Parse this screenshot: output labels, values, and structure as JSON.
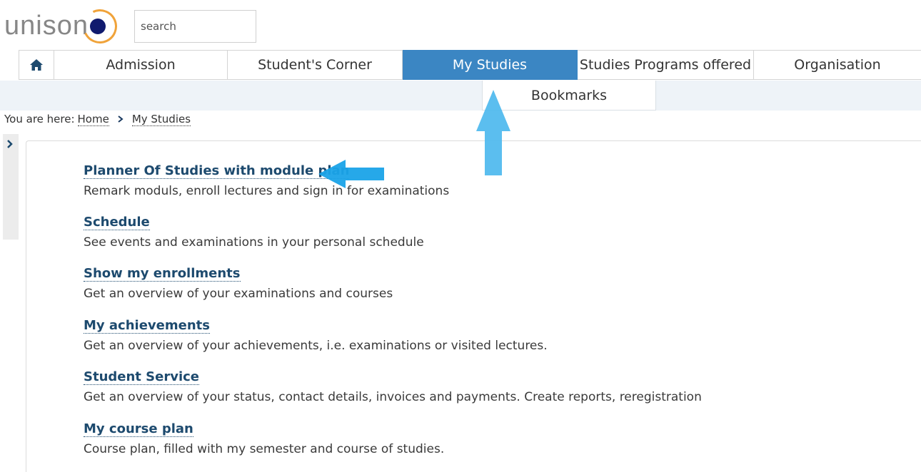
{
  "logo": {
    "text": "unison"
  },
  "search": {
    "placeholder": "search"
  },
  "nav": {
    "items": [
      {
        "label": "Admission"
      },
      {
        "label": "Student's Corner"
      },
      {
        "label": "My Studies",
        "active": true
      },
      {
        "label": "Studies Programs offered"
      },
      {
        "label": "Organisation"
      }
    ],
    "submenu": [
      {
        "label": "Bookmarks"
      }
    ]
  },
  "breadcrumb": {
    "prefix": "You are here:",
    "items": [
      {
        "label": "Home"
      },
      {
        "label": "My Studies"
      }
    ]
  },
  "content": {
    "entries": [
      {
        "title": "Planner Of Studies with module plan",
        "desc": "Remark moduls, enroll lectures and sign in for examinations"
      },
      {
        "title": "Schedule",
        "desc": "See events and examinations in your personal schedule"
      },
      {
        "title": "Show my enrollments",
        "desc": "Get an overview of your examinations and courses"
      },
      {
        "title": "My achievements",
        "desc": "Get an overview of your achievements, i.e. examinations or visited lectures."
      },
      {
        "title": "Student Service",
        "desc": "Get an overview of your status, contact details, invoices and payments. Create reports, reregistration"
      },
      {
        "title": "My course plan",
        "desc": "Course plan, filled with my semester and course of studies."
      }
    ]
  },
  "colors": {
    "nav_active": "#3b86c3",
    "link": "#1d4a6e",
    "annotation_arrow": "#4db8ee",
    "logo_ring": "#f0a33a",
    "logo_dot": "#101a6e"
  },
  "icons": {
    "home": "home-icon",
    "breadcrumb_separator": "chevron-right-icon",
    "side_toggle": "chevron-right-icon"
  }
}
